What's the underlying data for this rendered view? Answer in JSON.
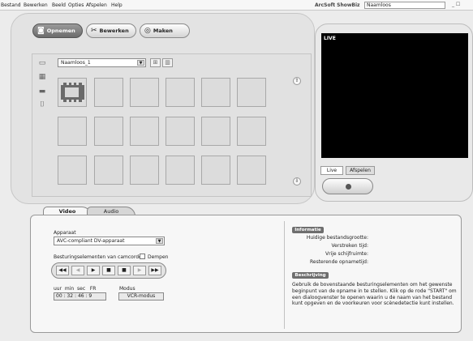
{
  "menu": [
    "Bestand",
    "Bewerken",
    "Beeld",
    "Opties",
    "Afspelen",
    "Help"
  ],
  "app_title": "ArcSoft ShowBiz",
  "project_name": "Naamloos",
  "window_buttons": "_ ☐",
  "mode_tabs": [
    "Opnemen",
    "Bewerken",
    "Maken"
  ],
  "album": {
    "selected": "Naamloos_1"
  },
  "preview": {
    "live_label": "LIVE",
    "tabs": [
      "Live",
      "Afspelen"
    ]
  },
  "bottom_tabs": [
    "Video",
    "Audio"
  ],
  "video": {
    "device_label": "Apparaat",
    "device_value": "AVC-compliant DV-apparaat",
    "controls_label": "Besturingselementen van camcorder",
    "mute_label": "Dempen",
    "tc_labels": "uur  min  sec   FR",
    "timecode": "00 : 32 : 46 : 9",
    "mode_label": "Modus",
    "mode_value": "VCR-modus"
  },
  "info": {
    "header": "Informatie",
    "rows": [
      "Huidige bestandsgrootte:",
      "Verstreken tijd:",
      "Vrije schijfruimte:",
      "Resterende opnametijd:"
    ],
    "desc_header": "Beschrijving",
    "description": "Gebruik de bovenstaande besturingselementen om het gewenste beginpunt van de opname in te stellen. Klik op de rode \"START\" om een dialoogvenster te openen waarin u de naam van het bestand kunt opgeven en de voorkeuren voor scènedetectie kunt instellen."
  },
  "icons": {
    "record": "camera-icon",
    "edit": "clapper-icon",
    "make": "disc-icon"
  },
  "colors": {
    "active_tab": "#7a7a7a",
    "screen": "#000000",
    "header_badge": "#6e6e6e"
  }
}
